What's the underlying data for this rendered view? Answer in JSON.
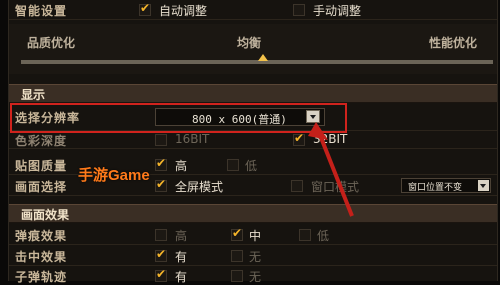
{
  "title_row": {
    "label": "智能设置",
    "auto_label": "自动调整",
    "manual_label": "手动调整"
  },
  "quality_slider": {
    "left_label": "品质优化",
    "mid_label": "均衡",
    "right_label": "性能优化",
    "level": 0.5
  },
  "display_section": {
    "title": "显示"
  },
  "resolution": {
    "label": "选择分辨率",
    "value": "800 x 600(普通)"
  },
  "color_depth": {
    "label": "色彩深度",
    "opt1": "16BIT",
    "opt2": "32BIT"
  },
  "texture": {
    "label": "贴图质量",
    "opt1": "高",
    "opt2": "低"
  },
  "screen_mode": {
    "label": "画面选择",
    "opt1": "全屏模式",
    "opt2": "窗口模式",
    "window_pos": "窗口位置不变"
  },
  "effects_section": {
    "title": "画面效果"
  },
  "bullet_effect": {
    "label": "弹痕效果",
    "opt1": "高",
    "opt2": "中",
    "opt3": "低"
  },
  "hit_effect": {
    "label": "击中效果",
    "opt1": "有",
    "opt2": "无"
  },
  "bullet_trail": {
    "label": "子弹轨迹",
    "opt1": "有",
    "opt2": "无"
  },
  "watermark": "手游Game",
  "colors": {
    "accent": "#f5b52a",
    "highlight": "#d0231d",
    "section": "#3a2e24"
  }
}
